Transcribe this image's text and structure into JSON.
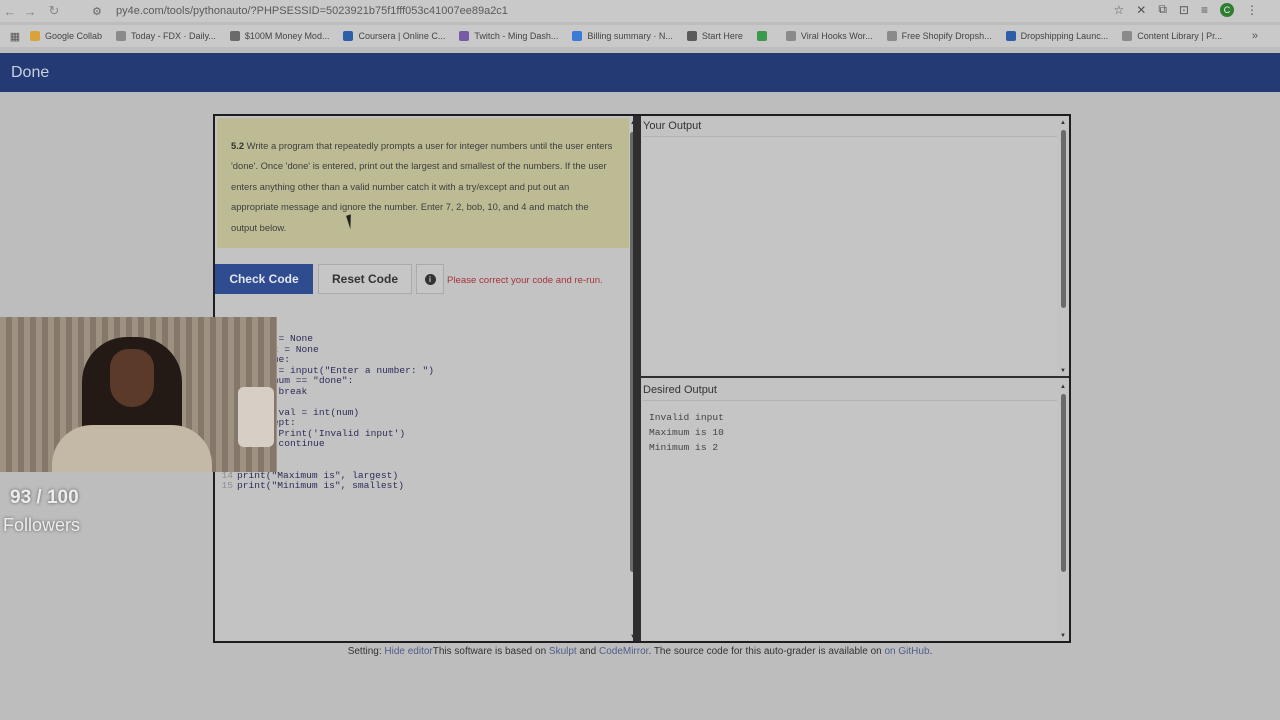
{
  "browser": {
    "url": "py4e.com/tools/pythonauto/?PHPSESSID=5023921b75f1fff053c41007ee89a2c1",
    "profile_initial": "C",
    "bookmarks": [
      {
        "label": "Google Collab",
        "color": "#d8a43a"
      },
      {
        "label": "Today - FDX · Daily...",
        "color": "#8a8a8a"
      },
      {
        "label": "$100M Money Mod...",
        "color": "#6a6a6a"
      },
      {
        "label": "Coursera | Online C...",
        "color": "#2f5ea8"
      },
      {
        "label": "Twitch - Ming Dash...",
        "color": "#7a5aa8"
      },
      {
        "label": "Billing summary · N...",
        "color": "#3a7ad8"
      },
      {
        "label": "Start Here",
        "color": "#5a5a5a"
      },
      {
        "label": "",
        "color": "#3a9a4a"
      },
      {
        "label": "Viral Hooks Wor...",
        "color": "#8a8a8a"
      },
      {
        "label": "Free Shopify Dropsh...",
        "color": "#8a8a8a"
      },
      {
        "label": "Dropshipping Launc...",
        "color": "#2f5ea8"
      },
      {
        "label": "Content Library | Pr...",
        "color": "#8a8a8a"
      }
    ]
  },
  "header": {
    "done_label": "Done"
  },
  "question": {
    "number": "5.2",
    "text": " Write a program that repeatedly prompts a user for integer numbers until the user enters 'done'. Once 'done' is entered, print out the largest and smallest of the numbers. If the user enters anything other than a valid number catch it with a try/except and put out an appropriate message and ignore the number. Enter 7, 2, bob, 10, and 4 and match the output below."
  },
  "buttons": {
    "check": "Check Code",
    "reset": "Reset Code",
    "info": "i"
  },
  "error_message": "Please correct your code and re-run.",
  "code_lines": [
    {
      "num": "",
      "text": "t = None"
    },
    {
      "num": "",
      "text": "st = None"
    },
    {
      "num": "",
      "text": "rue:"
    },
    {
      "num": "",
      "text": "m = input(\"Enter a number: \")"
    },
    {
      "num": "",
      "text": " num == \"done\":"
    },
    {
      "num": "",
      "text": "  break"
    },
    {
      "num": "",
      "text": "y:"
    },
    {
      "num": "",
      "text": "  val = int(num)"
    },
    {
      "num": "",
      "text": "cept:"
    },
    {
      "num": "",
      "text": "  Print('Invalid input')"
    },
    {
      "num": "",
      "text": "  continue"
    },
    {
      "num": "",
      "text": ""
    },
    {
      "num": "",
      "text": ""
    },
    {
      "num": "14",
      "text": "print(\"Maximum is\", largest)"
    },
    {
      "num": "15",
      "text": "print(\"Minimum is\", smallest)"
    }
  ],
  "your_output": {
    "title": "Your Output"
  },
  "desired_output": {
    "title": "Desired Output",
    "lines": [
      "Invalid input",
      "Maximum is 10",
      "Minimum is 2"
    ]
  },
  "footer": {
    "setting_label": "Setting: ",
    "hide_editor": "Hide editor",
    "text1": "This software is based on ",
    "skulpt": "Skulpt",
    "and": " and ",
    "codemirror": "CodeMirror",
    "text2": ". The source code for this auto-grader is available on ",
    "github": "on GitHub",
    "period": "."
  },
  "overlay": {
    "followers_count": "93 / 100",
    "followers_label": "Followers"
  }
}
